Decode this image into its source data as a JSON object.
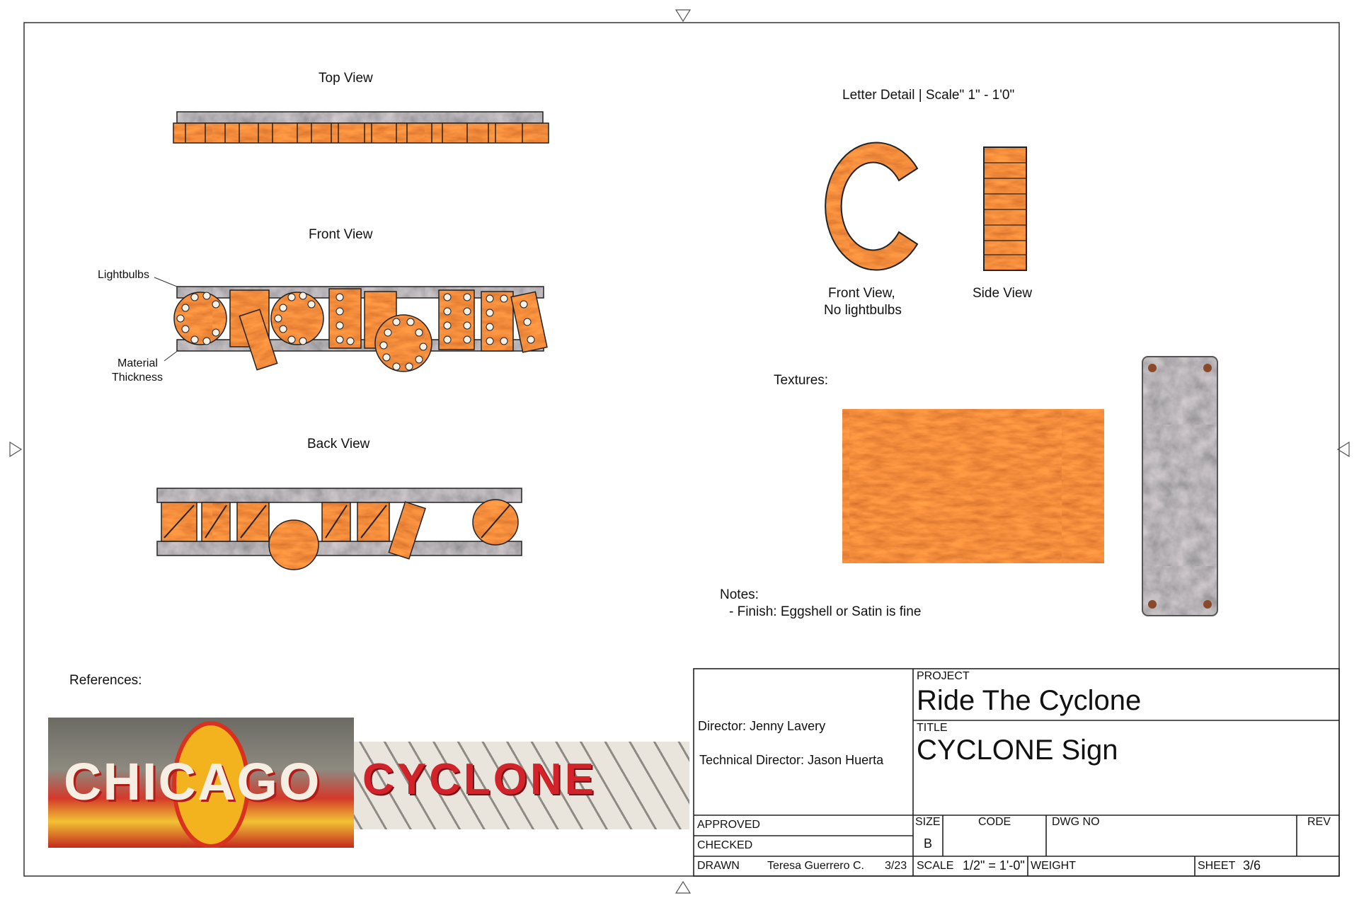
{
  "views": {
    "top": "Top View",
    "front": "Front View",
    "back": "Back View"
  },
  "callouts": {
    "lightbulbs": "Lightbulbs",
    "material_line1": "Material",
    "material_line2": "Thickness"
  },
  "letter_detail": {
    "heading": "Letter Detail |  Scale\" 1\" - 1'0\"",
    "front_caption_1": "Front View,",
    "front_caption_2": "No lightbulbs",
    "side_caption": "Side View"
  },
  "textures": {
    "label": "Textures:"
  },
  "notes": {
    "label": "Notes:",
    "item": "- Finish: Eggshell or Satin is fine"
  },
  "references": {
    "label": "References:",
    "sign1_text": "CHICAGO",
    "sign2_text": "CYCLONE"
  },
  "title_block": {
    "director": "Director: Jenny Lavery",
    "technical_director": "Technical Director: Jason Huerta",
    "project_label": "PROJECT",
    "project_value": "Ride The Cyclone",
    "title_label": "TITLE",
    "title_value": "CYCLONE Sign",
    "approved_label": "APPROVED",
    "checked_label": "CHECKED",
    "drawn_label": "DRAWN",
    "drawn_name": "Teresa Guerrero C.",
    "drawn_date": "3/23",
    "size_label": "SIZE",
    "size_value": "B",
    "code_label": "CODE",
    "dwg_label": "DWG NO",
    "rev_label": "REV",
    "scale_label": "SCALE",
    "scale_value": "1/2\" = 1'-0\"",
    "weight_label": "WEIGHT",
    "sheet_label": "SHEET",
    "sheet_value": "3/6"
  },
  "colors": {
    "rust": "#b8441c",
    "rust_dark": "#6e2410",
    "steel": "#6f7173",
    "steel_dark": "#45484b",
    "bulb": "#f6f1e4"
  }
}
